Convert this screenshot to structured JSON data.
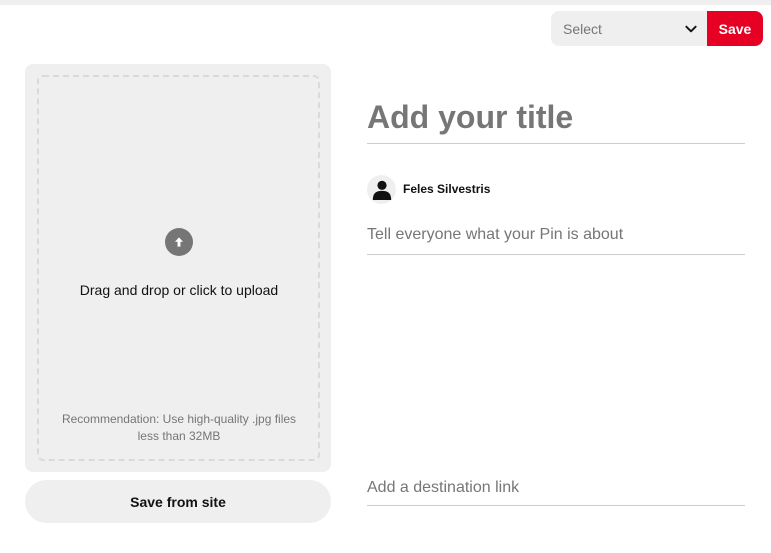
{
  "header": {
    "board_select": {
      "label": "Select",
      "icon": "chevron-down-icon"
    },
    "save_label": "Save"
  },
  "upload": {
    "icon": "upload-arrow-icon",
    "text": "Drag and drop or click to upload",
    "recommendation": "Recommendation: Use high-quality .jpg files less than 32MB"
  },
  "save_from_site_label": "Save from site",
  "pin": {
    "title_placeholder": "Add your title",
    "author_name": "Feles Silvestris",
    "description_placeholder": "Tell everyone what your Pin is about",
    "destination_placeholder": "Add a destination link"
  },
  "colors": {
    "accent": "#e60023",
    "panel": "#efefef",
    "muted_text": "#767676"
  }
}
